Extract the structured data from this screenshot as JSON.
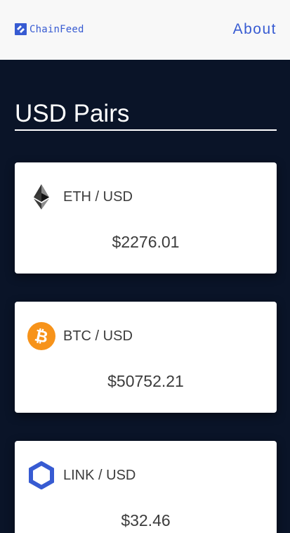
{
  "header": {
    "brand_name": "ChainFeed",
    "brand_icon": "chainfeed-logo-icon",
    "about_label": "About",
    "accent_color": "#375bd2"
  },
  "main": {
    "title": "USD Pairs",
    "pairs": [
      {
        "label": "ETH / USD",
        "price": "$2276.01",
        "icon": "ethereum-icon"
      },
      {
        "label": "BTC / USD",
        "price": "$50752.21",
        "icon": "bitcoin-icon"
      },
      {
        "label": "LINK / USD",
        "price": "$32.46",
        "icon": "chainlink-icon"
      }
    ]
  },
  "colors": {
    "background": "#0a1428",
    "header_background": "#f8f8f8",
    "card_background": "#ffffff",
    "bitcoin_orange": "#f7931a",
    "chainlink_blue": "#375bd2"
  }
}
